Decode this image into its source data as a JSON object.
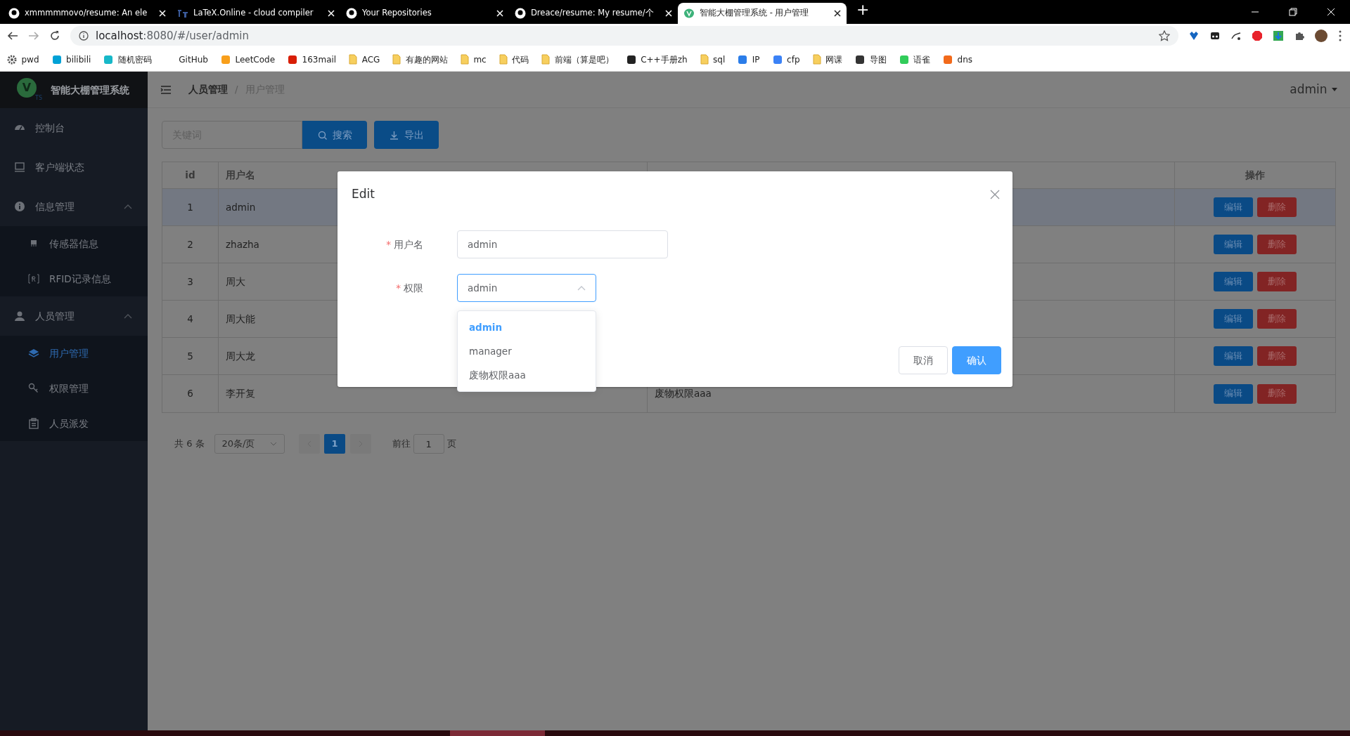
{
  "browser": {
    "tabs": [
      {
        "title": "xmmmmmovo/resume: An ele",
        "selected": false
      },
      {
        "title": "LaTeX.Online - cloud compiler",
        "selected": false
      },
      {
        "title": "Your Repositories",
        "selected": false
      },
      {
        "title": "Dreace/resume: My resume/个",
        "selected": false
      },
      {
        "title": "智能大棚管理系统 - 用户管理",
        "selected": true
      }
    ],
    "new_tab": "+",
    "address": {
      "host": "localhost",
      "path": ":8080/#/user/admin"
    },
    "bookmarks": [
      {
        "label": "pwd",
        "kind": "gear"
      },
      {
        "label": "bilibili",
        "kind": "site",
        "color": "#00a1d6"
      },
      {
        "label": "随机密码",
        "kind": "site",
        "color": "#17b8c8"
      },
      {
        "label": "GitHub",
        "kind": "none"
      },
      {
        "label": "LeetCode",
        "kind": "site",
        "color": "#f89f1b"
      },
      {
        "label": "163mail",
        "kind": "site",
        "color": "#d81e06"
      },
      {
        "label": "ACG",
        "kind": "folder"
      },
      {
        "label": "有趣的网站",
        "kind": "folder"
      },
      {
        "label": "mc",
        "kind": "folder"
      },
      {
        "label": "代码",
        "kind": "folder"
      },
      {
        "label": "前端（算是吧）",
        "kind": "folder"
      },
      {
        "label": "C++手册zh",
        "kind": "site",
        "color": "#222222"
      },
      {
        "label": "sql",
        "kind": "folder"
      },
      {
        "label": "IP",
        "kind": "site",
        "color": "#2b7de9"
      },
      {
        "label": "cfp",
        "kind": "site",
        "color": "#3b82f6"
      },
      {
        "label": "网课",
        "kind": "folder"
      },
      {
        "label": "导图",
        "kind": "site",
        "color": "#333333"
      },
      {
        "label": "语雀",
        "kind": "site",
        "color": "#31cc5a"
      },
      {
        "label": "dns",
        "kind": "site",
        "color": "#f26a1b"
      }
    ]
  },
  "app": {
    "logo": {
      "letter": "V",
      "sub": "TS"
    },
    "title": "智能大棚管理系统",
    "sidebar": [
      {
        "label": "控制台",
        "selected": false
      },
      {
        "label": "客户端状态",
        "selected": false
      },
      {
        "label": "信息管理",
        "expanded": true,
        "selected": false,
        "children": [
          {
            "label": "传感器信息",
            "selected": false
          },
          {
            "label": "RFID记录信息",
            "selected": false
          }
        ]
      },
      {
        "label": "人员管理",
        "expanded": true,
        "selected": false,
        "children": [
          {
            "label": "用户管理",
            "selected": true
          },
          {
            "label": "权限管理",
            "selected": false
          },
          {
            "label": "人员派发",
            "selected": false
          }
        ]
      }
    ],
    "breadcrumb_separator": "/",
    "breadcrumb": [
      {
        "label": "人员管理",
        "current": false
      },
      {
        "label": "用户管理",
        "current": true
      }
    ],
    "user": "admin",
    "search": {
      "placeholder": "关键词"
    },
    "toolbar_buttons": [
      {
        "label": "搜索",
        "kind": "search"
      },
      {
        "label": "导出",
        "kind": "download"
      }
    ],
    "table": {
      "columns": [
        "id",
        "用户名",
        "",
        "操作"
      ],
      "rows": [
        {
          "id": "1",
          "username": "admin",
          "column_3": "",
          "hovered": true,
          "actions": [
            "编辑",
            "删除"
          ]
        },
        {
          "id": "2",
          "username": "zhazha",
          "column_3": "",
          "hovered": false,
          "actions": [
            "编辑",
            "删除"
          ]
        },
        {
          "id": "3",
          "username": "周大",
          "column_3": "",
          "hovered": false,
          "actions": [
            "编辑",
            "删除"
          ]
        },
        {
          "id": "4",
          "username": "周大能",
          "column_3": "",
          "hovered": false,
          "actions": [
            "编辑",
            "删除"
          ]
        },
        {
          "id": "5",
          "username": "周大龙",
          "column_3": "",
          "hovered": false,
          "actions": [
            "编辑",
            "删除"
          ]
        },
        {
          "id": "6",
          "username": "李开复",
          "column_3": "废物权限aaa",
          "hovered": false,
          "actions": [
            "编辑",
            "删除"
          ]
        }
      ]
    },
    "pagination": {
      "total": "共 6 条",
      "page_size": "20条/页",
      "pages": [
        {
          "label": "1",
          "selected": true
        }
      ],
      "goto_label": "前往",
      "goto_value": "1",
      "goto_suffix": "页"
    },
    "dialog": {
      "title": "Edit",
      "required_mark": "*",
      "fields": [
        {
          "label": "用户名",
          "required": true,
          "kind": "input",
          "value": "admin"
        },
        {
          "label": "权限",
          "required": true,
          "kind": "select",
          "value": "admin",
          "open": true,
          "options": [
            {
              "label": "admin",
              "selected": true
            },
            {
              "label": "manager",
              "selected": false
            },
            {
              "label": "废物权限aaa",
              "selected": false
            }
          ]
        }
      ],
      "buttons": [
        {
          "label": "取消",
          "kind": "default"
        },
        {
          "label": "确认",
          "kind": "primary"
        }
      ]
    }
  }
}
